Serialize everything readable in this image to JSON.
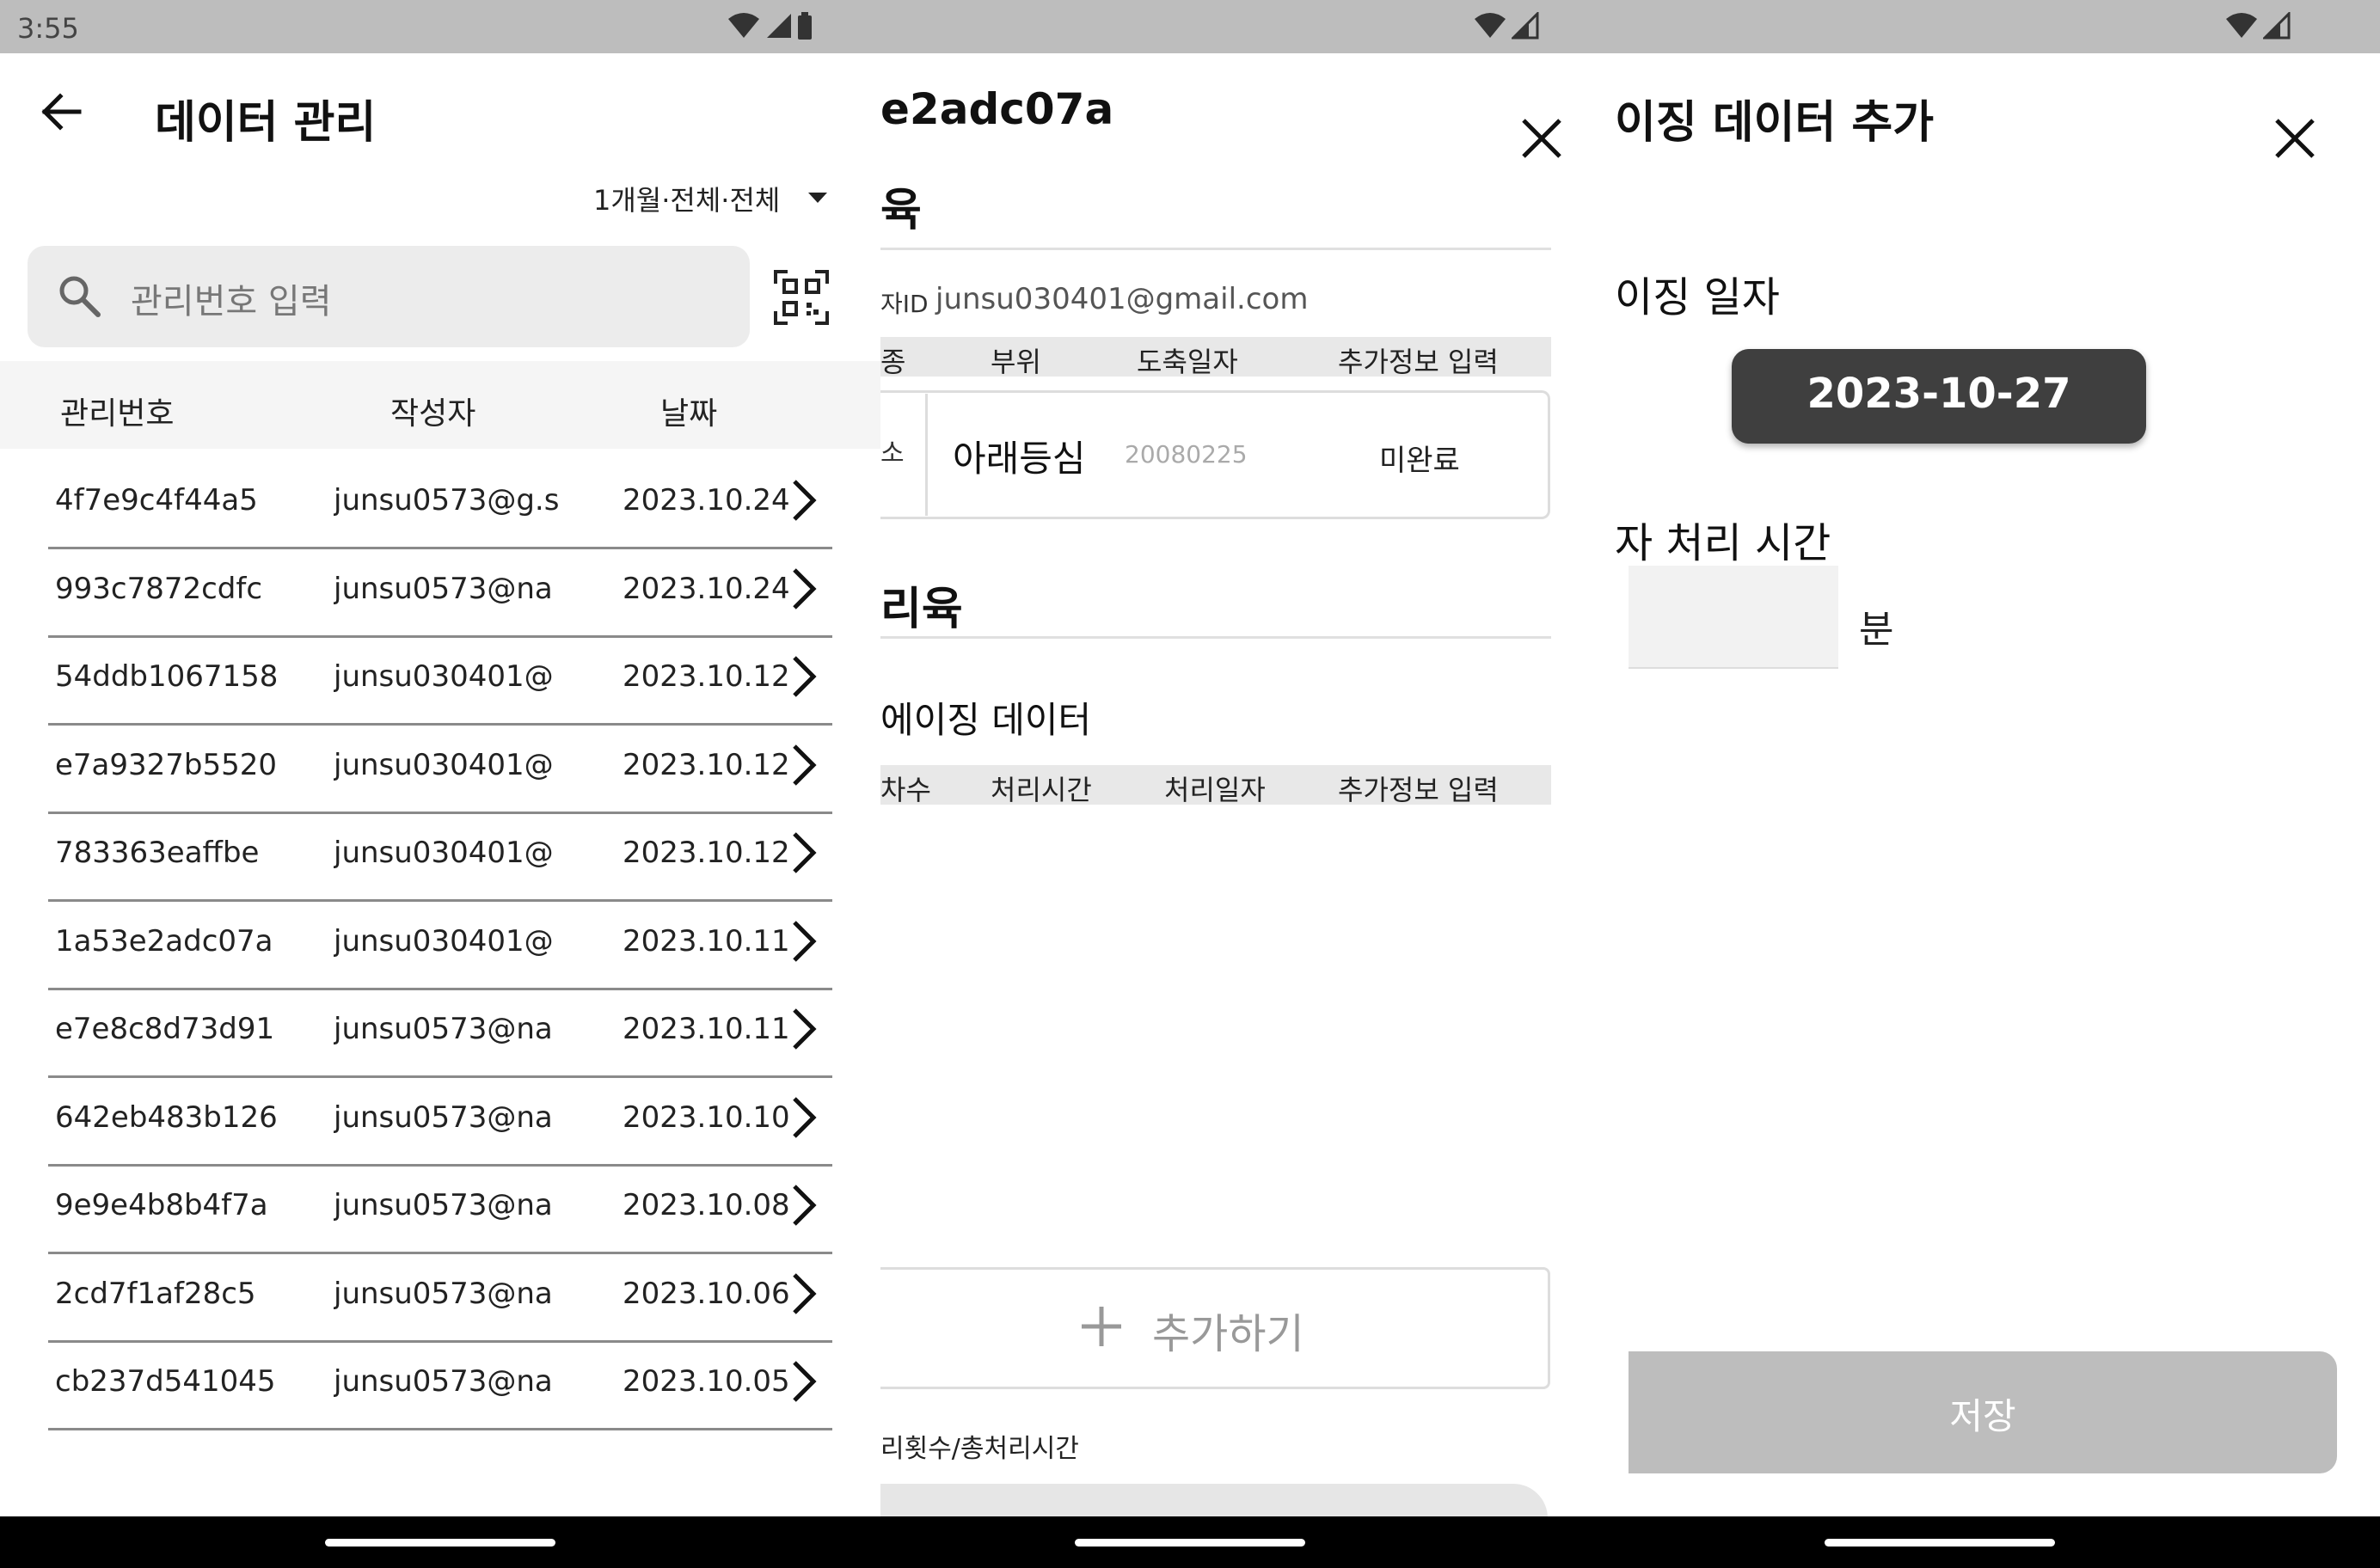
{
  "status_bar": {
    "time": "3:55"
  },
  "list_screen": {
    "title": "데이터 관리",
    "filter_label": "1개월·전체·전체",
    "search_placeholder": "관리번호 입력",
    "columns": [
      "관리번호",
      "작성자",
      "날짜"
    ],
    "rows": [
      {
        "id": "4f7e9c4f44a5",
        "author": "junsu0573@g.s",
        "date": "2023.10.24"
      },
      {
        "id": "993c7872cdfc",
        "author": "junsu0573@na",
        "date": "2023.10.24"
      },
      {
        "id": "54ddb1067158",
        "author": "junsu030401@",
        "date": "2023.10.12"
      },
      {
        "id": "e7a9327b5520",
        "author": "junsu030401@",
        "date": "2023.10.12"
      },
      {
        "id": "783363eaffbe",
        "author": "junsu030401@",
        "date": "2023.10.12"
      },
      {
        "id": "1a53e2adc07a",
        "author": "junsu030401@",
        "date": "2023.10.11"
      },
      {
        "id": "e7e8c8d73d91",
        "author": "junsu0573@na",
        "date": "2023.10.11"
      },
      {
        "id": "642eb483b126",
        "author": "junsu0573@na",
        "date": "2023.10.10"
      },
      {
        "id": "9e9e4b8b4f7a",
        "author": "junsu0573@na",
        "date": "2023.10.08"
      },
      {
        "id": "2cd7f1af28c5",
        "author": "junsu0573@na",
        "date": "2023.10.06"
      },
      {
        "id": "cb237d541045",
        "author": "junsu0573@na",
        "date": "2023.10.05"
      }
    ]
  },
  "detail_screen": {
    "title": "e2adc07a",
    "section1_heading": "육",
    "user_label": "자ID",
    "user_email": "junsu030401@gmail.com",
    "table1_headers": [
      "종",
      "부위",
      "도축일자",
      "추가정보 입력"
    ],
    "table1_row": {
      "c0": "소",
      "part": "아래등심",
      "date": "20080225",
      "status": "미완료"
    },
    "section2_heading": "리육",
    "subheading": "에이징 데이터",
    "table2_headers": [
      "차수",
      "처리시간",
      "처리일자",
      "추가정보 입력"
    ],
    "add_button": "추가하기",
    "summary_label": "리횟수/총처리시간"
  },
  "aging_screen": {
    "title": "이징 데이터 추가",
    "date_label": "이징 일자",
    "date_value": "2023-10-27",
    "time_label": "자 처리 시간",
    "minutes_value": "",
    "unit": "분",
    "save_button": "저장"
  }
}
